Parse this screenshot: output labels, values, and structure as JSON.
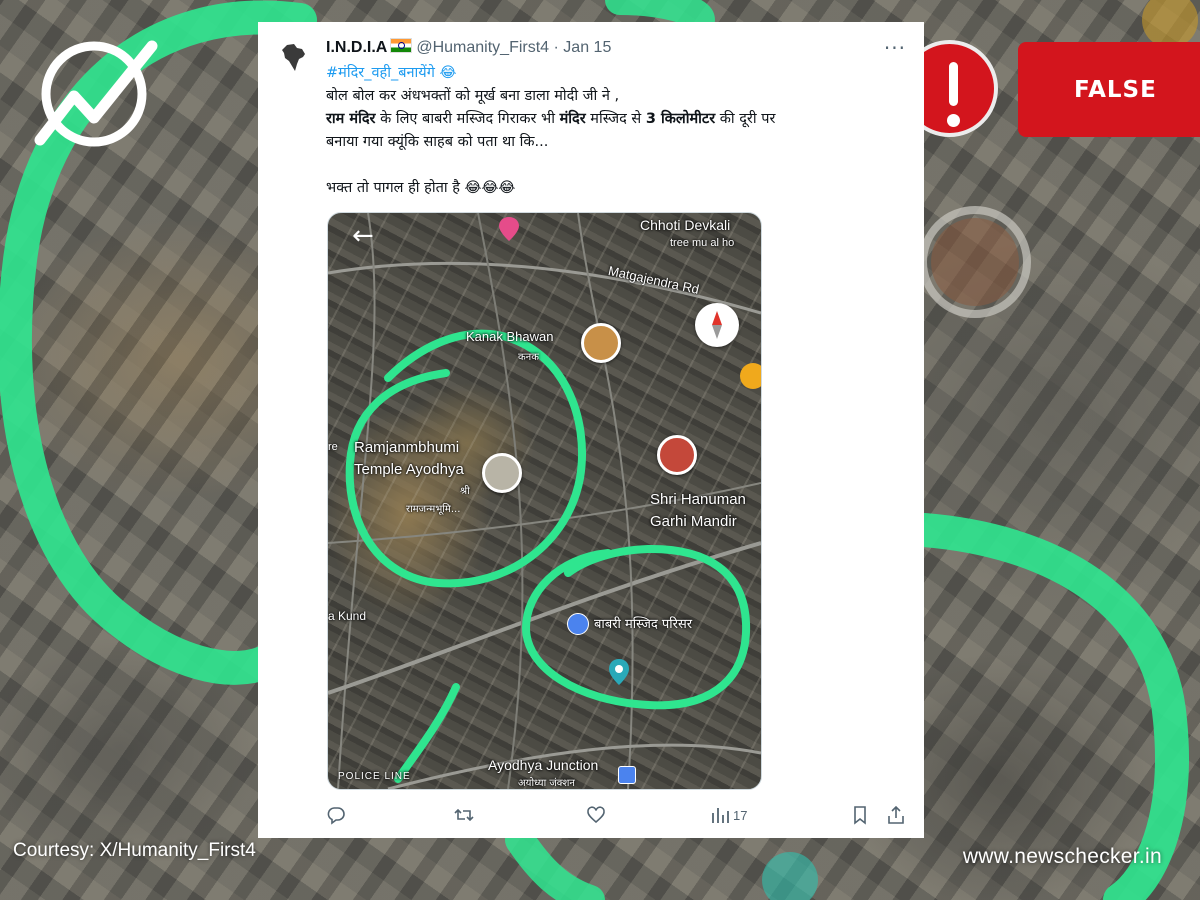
{
  "overlay": {
    "verdict": "FALSE",
    "courtesy": "Courtesy: X/Humanity_First4",
    "site_url": "www.newschecker.in",
    "colors": {
      "verdict_red": "#d3151d",
      "accent_green": "#2fe58f"
    }
  },
  "tweet": {
    "display_name": "I.N.D.I.A",
    "handle": "@Humanity_First4",
    "separator": "·",
    "date": "Jan 15",
    "more_icon": "more-dots-icon",
    "hashtag": "#मंदिर_वही_बनायेंगे 😂",
    "line_1": "बोल बोल कर अंधभक्तों को मूर्ख बना डाला मोदी जी ने ,",
    "line_2_bold_a": "राम मंदिर",
    "line_2_mid": " के लिए बाबरी मस्जिद गिराकर भी  ",
    "line_2_bold_b": "मंदिर",
    "line_2_mid2": " मस्जिद से ",
    "line_2_bold_c": "3 किलोमीटर",
    "line_2_end": " की दूरी पर",
    "line_3": "बनाया गया क्यूंकि साहब को पता था कि...",
    "line_4": "भक्त तो पागल ही होता है  😂😂😂",
    "map_labels": {
      "chhoti": "Chhoti Devkali",
      "tree": "tree mu   al ho",
      "matgajendra": "Matgajendra Rd",
      "kanak": "Kanak Bhawan",
      "kanak_hi": "कनक",
      "ramjanm_1": "Ramjanmbhumi",
      "ramjanm_2": "Temple Ayodhya",
      "ramjanm_hi": "रामजन्मभूमि...",
      "ramjanm_hi2": "श्री",
      "hanuman_1": "Shri Hanuman",
      "hanuman_2": "Garhi Mandir",
      "babri": "बाबरी मस्जिद परिसर",
      "kund": "a Kund",
      "ayodhya_jn": "Ayodhya Junction",
      "ayodhya_jn_hi": "अयोध्या जंक्शन",
      "police": "POLICE LINE",
      "re": "re"
    },
    "stats": {
      "views": "17"
    },
    "icons": [
      "reply-icon",
      "retweet-icon",
      "like-icon",
      "views-icon",
      "bookmark-icon",
      "share-icon"
    ]
  }
}
